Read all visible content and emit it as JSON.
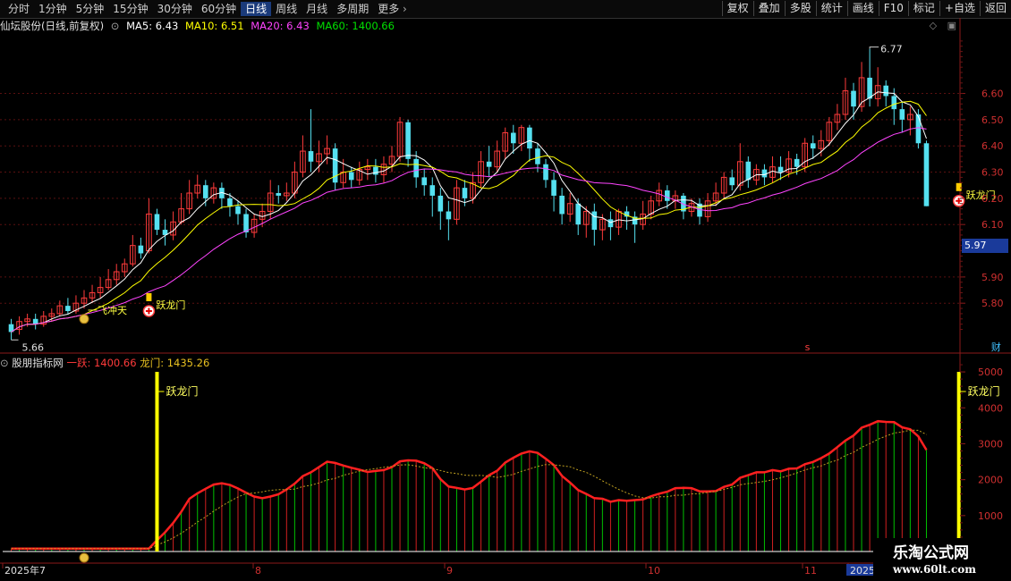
{
  "toolbar": {
    "periods": [
      "分时",
      "1分钟",
      "5分钟",
      "15分钟",
      "30分钟",
      "60分钟",
      "日线",
      "周线",
      "月线",
      "多周期",
      "更多"
    ],
    "active_period": "日线",
    "actions": [
      "复权",
      "叠加",
      "多股",
      "统计",
      "画线",
      "F10",
      "标记",
      "+自选",
      "返回"
    ]
  },
  "stock": {
    "title": "仙坛股份(日线,前复权)",
    "ma5_label": "MA5: 6.43",
    "ma10_label": "MA10: 6.51",
    "ma20_label": "MA20: 6.43",
    "ma60_label": "MA60: 1400.66",
    "high_label": "6.77",
    "low_label": "5.66",
    "current_price": "5.97",
    "price_ticks": [
      "6.60",
      "6.50",
      "6.40",
      "6.30",
      "6.20",
      "6.10",
      "5.90",
      "5.80"
    ],
    "annotation_1": "跃龙门",
    "annotation_2": "跃龙门",
    "annotation_3": "一飞冲天",
    "annotation_4": "跃龙门",
    "marker_s": "s",
    "marker_cai": "财",
    "colors": {
      "up": "#ff3b3b",
      "down": "#55e0f0",
      "ma5": "#ffffff",
      "ma10": "#ffff00",
      "ma20": "#ff44ff",
      "ma60": "#00e000"
    }
  },
  "indicator": {
    "name": "股朋指标网",
    "yiyue_label": "一跃: 1400.66",
    "longmen_label": "龙门: 1435.26",
    "signal_1": "跃龙门",
    "signal_2": "跃龙门",
    "axis_ticks": [
      "5000",
      "4000",
      "3000",
      "2000",
      "1000"
    ]
  },
  "xaxis": {
    "labels": [
      "2025年7",
      "8",
      "9",
      "10",
      "11",
      "2025年"
    ]
  },
  "watermark": {
    "brand": "乐淘公式网",
    "url": "www.60lt.com"
  },
  "chart_data": {
    "type": "candlestick",
    "price_ylim": [
      5.62,
      6.82
    ],
    "candles": [
      [
        5.72,
        5.69,
        5.74,
        5.66
      ],
      [
        5.7,
        5.73,
        5.75,
        5.68
      ],
      [
        5.73,
        5.74,
        5.76,
        5.71
      ],
      [
        5.74,
        5.72,
        5.76,
        5.7
      ],
      [
        5.72,
        5.75,
        5.77,
        5.71
      ],
      [
        5.75,
        5.76,
        5.78,
        5.73
      ],
      [
        5.76,
        5.79,
        5.81,
        5.75
      ],
      [
        5.79,
        5.77,
        5.82,
        5.76
      ],
      [
        5.77,
        5.8,
        5.83,
        5.76
      ],
      [
        5.8,
        5.82,
        5.85,
        5.78
      ],
      [
        5.82,
        5.84,
        5.87,
        5.8
      ],
      [
        5.84,
        5.86,
        5.9,
        5.82
      ],
      [
        5.86,
        5.89,
        5.93,
        5.85
      ],
      [
        5.89,
        5.92,
        5.95,
        5.87
      ],
      [
        5.92,
        5.95,
        5.97,
        5.9
      ],
      [
        5.95,
        6.02,
        6.06,
        5.94
      ],
      [
        6.02,
        5.99,
        6.05,
        5.97
      ],
      [
        6.0,
        6.14,
        6.2,
        5.99
      ],
      [
        6.14,
        6.08,
        6.16,
        6.06
      ],
      [
        6.08,
        6.06,
        6.12,
        6.02
      ],
      [
        6.06,
        6.11,
        6.15,
        6.04
      ],
      [
        6.11,
        6.16,
        6.22,
        6.1
      ],
      [
        6.16,
        6.22,
        6.27,
        6.14
      ],
      [
        6.22,
        6.25,
        6.29,
        6.2
      ],
      [
        6.25,
        6.2,
        6.27,
        6.17
      ],
      [
        6.2,
        6.24,
        6.26,
        6.18
      ],
      [
        6.24,
        6.2,
        6.26,
        6.16
      ],
      [
        6.2,
        6.17,
        6.22,
        6.13
      ],
      [
        6.17,
        6.14,
        6.19,
        6.1
      ],
      [
        6.14,
        6.07,
        6.16,
        6.05
      ],
      [
        6.07,
        6.12,
        6.14,
        6.05
      ],
      [
        6.12,
        6.15,
        6.18,
        6.09
      ],
      [
        6.15,
        6.22,
        6.27,
        6.12
      ],
      [
        6.22,
        6.21,
        6.25,
        6.18
      ],
      [
        6.21,
        6.22,
        6.26,
        6.19
      ],
      [
        6.22,
        6.3,
        6.34,
        6.2
      ],
      [
        6.3,
        6.38,
        6.44,
        6.28
      ],
      [
        6.38,
        6.34,
        6.54,
        6.3
      ],
      [
        6.34,
        6.37,
        6.42,
        6.3
      ],
      [
        6.37,
        6.39,
        6.44,
        6.33
      ],
      [
        6.39,
        6.26,
        6.41,
        6.23
      ],
      [
        6.26,
        6.3,
        6.35,
        6.24
      ],
      [
        6.3,
        6.27,
        6.32,
        6.24
      ],
      [
        6.27,
        6.31,
        6.34,
        6.25
      ],
      [
        6.31,
        6.32,
        6.35,
        6.27
      ],
      [
        6.32,
        6.29,
        6.35,
        6.26
      ],
      [
        6.29,
        6.33,
        6.36,
        6.26
      ],
      [
        6.33,
        6.36,
        6.4,
        6.3
      ],
      [
        6.36,
        6.49,
        6.51,
        6.34
      ],
      [
        6.49,
        6.35,
        6.5,
        6.32
      ],
      [
        6.35,
        6.28,
        6.38,
        6.24
      ],
      [
        6.28,
        6.25,
        6.31,
        6.21
      ],
      [
        6.25,
        6.21,
        6.28,
        6.13
      ],
      [
        6.21,
        6.15,
        6.24,
        6.08
      ],
      [
        6.15,
        6.12,
        6.19,
        6.04
      ],
      [
        6.12,
        6.24,
        6.27,
        6.1
      ],
      [
        6.24,
        6.2,
        6.27,
        6.17
      ],
      [
        6.2,
        6.26,
        6.3,
        6.18
      ],
      [
        6.26,
        6.34,
        6.38,
        6.24
      ],
      [
        6.34,
        6.32,
        6.4,
        6.28
      ],
      [
        6.32,
        6.38,
        6.42,
        6.3
      ],
      [
        6.38,
        6.45,
        6.47,
        6.35
      ],
      [
        6.45,
        6.41,
        6.48,
        6.37
      ],
      [
        6.41,
        6.47,
        6.48,
        6.38
      ],
      [
        6.47,
        6.39,
        6.48,
        6.34
      ],
      [
        6.39,
        6.33,
        6.41,
        6.3
      ],
      [
        6.33,
        6.27,
        6.35,
        6.24
      ],
      [
        6.27,
        6.21,
        6.3,
        6.15
      ],
      [
        6.21,
        6.14,
        6.24,
        6.1
      ],
      [
        6.14,
        6.18,
        6.22,
        6.11
      ],
      [
        6.18,
        6.1,
        6.2,
        6.06
      ],
      [
        6.1,
        6.15,
        6.17,
        6.05
      ],
      [
        6.15,
        6.08,
        6.18,
        6.02
      ],
      [
        6.08,
        6.12,
        6.14,
        6.04
      ],
      [
        6.12,
        6.09,
        6.15,
        6.04
      ],
      [
        6.09,
        6.15,
        6.16,
        6.06
      ],
      [
        6.15,
        6.13,
        6.17,
        6.08
      ],
      [
        6.13,
        6.1,
        6.15,
        6.03
      ],
      [
        6.1,
        6.14,
        6.19,
        6.08
      ],
      [
        6.14,
        6.19,
        6.21,
        6.12
      ],
      [
        6.19,
        6.23,
        6.26,
        6.17
      ],
      [
        6.23,
        6.19,
        6.25,
        6.16
      ],
      [
        6.19,
        6.21,
        6.23,
        6.16
      ],
      [
        6.21,
        6.15,
        6.22,
        6.12
      ],
      [
        6.15,
        6.18,
        6.2,
        6.13
      ],
      [
        6.18,
        6.13,
        6.2,
        6.1
      ],
      [
        6.13,
        6.19,
        6.22,
        6.11
      ],
      [
        6.19,
        6.22,
        6.26,
        6.17
      ],
      [
        6.22,
        6.28,
        6.3,
        6.2
      ],
      [
        6.28,
        6.25,
        6.31,
        6.23
      ],
      [
        6.25,
        6.34,
        6.41,
        6.23
      ],
      [
        6.34,
        6.27,
        6.36,
        6.24
      ],
      [
        6.27,
        6.31,
        6.33,
        6.25
      ],
      [
        6.31,
        6.28,
        6.33,
        6.25
      ],
      [
        6.28,
        6.32,
        6.36,
        6.26
      ],
      [
        6.32,
        6.3,
        6.36,
        6.27
      ],
      [
        6.3,
        6.35,
        6.38,
        6.28
      ],
      [
        6.35,
        6.32,
        6.37,
        6.29
      ],
      [
        6.32,
        6.41,
        6.43,
        6.3
      ],
      [
        6.41,
        6.39,
        6.44,
        6.35
      ],
      [
        6.39,
        6.42,
        6.46,
        6.36
      ],
      [
        6.42,
        6.49,
        6.51,
        6.4
      ],
      [
        6.49,
        6.52,
        6.56,
        6.46
      ],
      [
        6.52,
        6.61,
        6.66,
        6.5
      ],
      [
        6.61,
        6.55,
        6.64,
        6.5
      ],
      [
        6.55,
        6.66,
        6.72,
        6.53
      ],
      [
        6.66,
        6.58,
        6.77,
        6.55
      ],
      [
        6.58,
        6.63,
        6.7,
        6.55
      ],
      [
        6.63,
        6.59,
        6.65,
        6.55
      ],
      [
        6.59,
        6.54,
        6.62,
        6.48
      ],
      [
        6.54,
        6.5,
        6.57,
        6.45
      ],
      [
        6.5,
        6.52,
        6.55,
        6.44
      ],
      [
        6.52,
        6.41,
        6.54,
        6.39
      ],
      [
        6.41,
        6.17,
        6.42,
        6.17
      ]
    ],
    "indicator_ylim": [
      0,
      5400
    ],
    "signal_bars": [
      18,
      117
    ]
  }
}
